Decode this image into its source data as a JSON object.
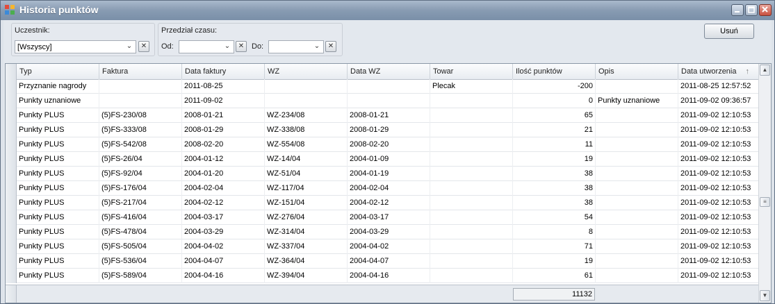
{
  "window": {
    "title": "Historia punktów"
  },
  "filters": {
    "participant": {
      "label": "Uczestnik:",
      "value": "[Wszyscy]"
    },
    "period": {
      "label": "Przedział czasu:",
      "from_label": "Od:",
      "from_value": "",
      "to_label": "Do:",
      "to_value": ""
    },
    "clear_glyph": "✕",
    "dropdown_glyph": "⌄"
  },
  "actions": {
    "delete_label": "Usuń"
  },
  "grid": {
    "columns": [
      "Typ",
      "Faktura",
      "Data faktury",
      "WZ",
      "Data WZ",
      "Towar",
      "Ilość punktów",
      "Opis",
      "Data utworzenia"
    ],
    "sort_indicator": "↑",
    "rows": [
      [
        "Przyznanie nagrody",
        "",
        "2011-08-25",
        "",
        "",
        "Plecak",
        "-200",
        "",
        "2011-08-25 12:57:52"
      ],
      [
        "Punkty uznaniowe",
        "",
        "2011-09-02",
        "",
        "",
        "",
        "0",
        "Punkty uznaniowe",
        "2011-09-02 09:36:57"
      ],
      [
        "Punkty PLUS",
        "(5)FS-230/08",
        "2008-01-21",
        "WZ-234/08",
        "2008-01-21",
        "",
        "65",
        "",
        "2011-09-02 12:10:53"
      ],
      [
        "Punkty PLUS",
        "(5)FS-333/08",
        "2008-01-29",
        "WZ-338/08",
        "2008-01-29",
        "",
        "21",
        "",
        "2011-09-02 12:10:53"
      ],
      [
        "Punkty PLUS",
        "(5)FS-542/08",
        "2008-02-20",
        "WZ-554/08",
        "2008-02-20",
        "",
        "11",
        "",
        "2011-09-02 12:10:53"
      ],
      [
        "Punkty PLUS",
        "(5)FS-26/04",
        "2004-01-12",
        "WZ-14/04",
        "2004-01-09",
        "",
        "19",
        "",
        "2011-09-02 12:10:53"
      ],
      [
        "Punkty PLUS",
        "(5)FS-92/04",
        "2004-01-20",
        "WZ-51/04",
        "2004-01-19",
        "",
        "38",
        "",
        "2011-09-02 12:10:53"
      ],
      [
        "Punkty PLUS",
        "(5)FS-176/04",
        "2004-02-04",
        "WZ-117/04",
        "2004-02-04",
        "",
        "38",
        "",
        "2011-09-02 12:10:53"
      ],
      [
        "Punkty PLUS",
        "(5)FS-217/04",
        "2004-02-12",
        "WZ-151/04",
        "2004-02-12",
        "",
        "38",
        "",
        "2011-09-02 12:10:53"
      ],
      [
        "Punkty PLUS",
        "(5)FS-416/04",
        "2004-03-17",
        "WZ-276/04",
        "2004-03-17",
        "",
        "54",
        "",
        "2011-09-02 12:10:53"
      ],
      [
        "Punkty PLUS",
        "(5)FS-478/04",
        "2004-03-29",
        "WZ-314/04",
        "2004-03-29",
        "",
        "8",
        "",
        "2011-09-02 12:10:53"
      ],
      [
        "Punkty PLUS",
        "(5)FS-505/04",
        "2004-04-02",
        "WZ-337/04",
        "2004-04-02",
        "",
        "71",
        "",
        "2011-09-02 12:10:53"
      ],
      [
        "Punkty PLUS",
        "(5)FS-536/04",
        "2004-04-07",
        "WZ-364/04",
        "2004-04-07",
        "",
        "19",
        "",
        "2011-09-02 12:10:53"
      ],
      [
        "Punkty PLUS",
        "(5)FS-589/04",
        "2004-04-16",
        "WZ-394/04",
        "2004-04-16",
        "",
        "61",
        "",
        "2011-09-02 12:10:53"
      ]
    ],
    "total_points": "11132"
  },
  "icons": {
    "app": "app-icon",
    "minimize": "minimize-icon",
    "maximize": "maximize-icon",
    "close": "close-icon"
  },
  "colors": {
    "titlebar": "#889bb2",
    "close_button": "#c9503f"
  }
}
